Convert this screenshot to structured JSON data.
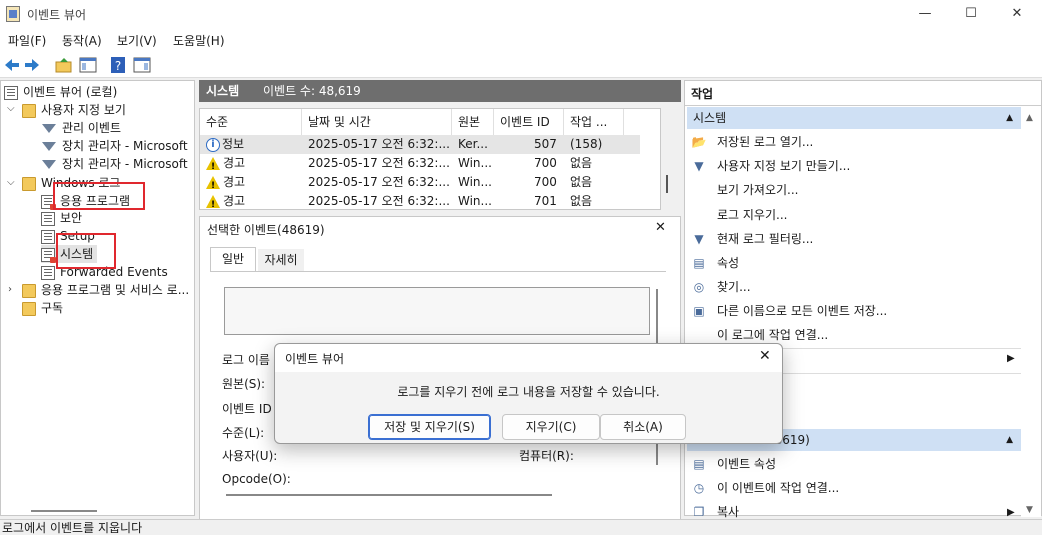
{
  "window": {
    "title": "이벤트 뷰어",
    "min": "—",
    "max": "☐",
    "close": "✕"
  },
  "menu": [
    "파일(F)",
    "동작(A)",
    "보기(V)",
    "도움말(H)"
  ],
  "tree": {
    "root": "이벤트 뷰어 (로컬)",
    "custom_views": "사용자 지정 보기",
    "admin_events": "관리 이벤트",
    "device_mgr1": "장치 관리자 - Microsoft",
    "device_mgr2": "장치 관리자 - Microsoft",
    "windows_logs": "Windows 로그",
    "application": "응용 프로그램",
    "security": "보안",
    "setup": "Setup",
    "system": "시스템",
    "forwarded": "Forwarded Events",
    "app_services": "응용 프로그램 및 서비스 로...",
    "subscriptions": "구독"
  },
  "events_panel": {
    "title": "시스템",
    "count": "이벤트 수: 48,619",
    "columns": [
      "수준",
      "날짜 및 시간",
      "원본",
      "이벤트 ID",
      "작업 ..."
    ],
    "rows": [
      {
        "level": "정보",
        "type": "info",
        "date": "2025-05-17 오전 6:32:...",
        "source": "Ker...",
        "id": "507",
        "task": "(158)"
      },
      {
        "level": "경고",
        "type": "warn",
        "date": "2025-05-17 오전 6:32:...",
        "source": "Win...",
        "id": "700",
        "task": "없음"
      },
      {
        "level": "경고",
        "type": "warn",
        "date": "2025-05-17 오전 6:32:...",
        "source": "Win...",
        "id": "700",
        "task": "없음"
      },
      {
        "level": "경고",
        "type": "warn",
        "date": "2025-05-17 오전 6:32:...",
        "source": "Win...",
        "id": "701",
        "task": "없음"
      }
    ]
  },
  "detail": {
    "title": "선택한 이벤트(48619)",
    "close": "✕",
    "tabs": [
      "일반",
      "자세히"
    ],
    "labels": {
      "log_name": "로그 이름",
      "source": "원본(S):",
      "event_id": "이벤트 ID",
      "level": "수준(L):",
      "user": "사용자(U):",
      "opcode": "Opcode(O):",
      "computer": "컴퓨터(R):"
    }
  },
  "actions": {
    "header": "작업",
    "section1": "시스템",
    "items1": [
      {
        "icon": "folder-open-icon",
        "label": "저장된 로그 열기..."
      },
      {
        "icon": "filter-icon",
        "label": "사용자 지정 보기 만들기..."
      },
      {
        "icon": "",
        "label": "보기 가져오기..."
      },
      {
        "icon": "",
        "label": "로그 지우기..."
      },
      {
        "icon": "filter-icon",
        "label": "현재 로그 필터링..."
      },
      {
        "icon": "properties-icon",
        "label": "속성"
      },
      {
        "icon": "binoculars-icon",
        "label": "찾기..."
      },
      {
        "icon": "save-icon",
        "label": "다른 이름으로 모든 이벤트 저장..."
      },
      {
        "icon": "",
        "label": "이 로그에 작업 연결..."
      }
    ],
    "section2": "48619)",
    "items2": [
      {
        "icon": "properties-icon",
        "label": "이벤트 속성"
      },
      {
        "icon": "task-icon",
        "label": "이 이벤트에 작업 연결..."
      },
      {
        "icon": "copy-icon",
        "label": "복사"
      }
    ]
  },
  "dialog": {
    "title": "이벤트 뷰어",
    "message": "로그를 지우기 전에 로그 내용을 저장할 수 있습니다.",
    "save_clear": "저장 및 지우기(S)",
    "clear": "지우기(C)",
    "cancel": "취소(A)"
  },
  "status": "로그에서 이벤트를 지웁니다"
}
